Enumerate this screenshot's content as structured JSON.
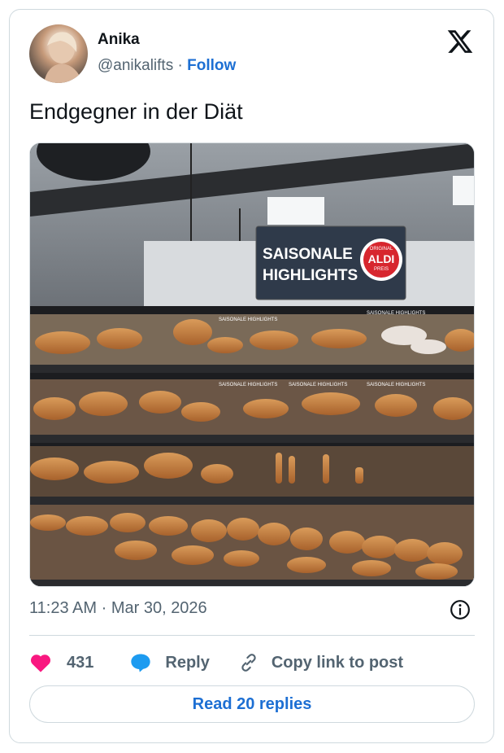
{
  "author": {
    "name": "Anika",
    "handle": "@anikalifts",
    "separator": "·",
    "follow_label": "Follow"
  },
  "post": {
    "text": "Endgegner in der Diät",
    "time": "11:23 AM",
    "date_separator": "·",
    "date": "Mar 30, 2026"
  },
  "photo": {
    "sign_line1": "SAISONALE",
    "sign_line2": "HIGHLIGHTS",
    "badge_top": "ORIGINAL",
    "badge_brand": "ALDI",
    "badge_bottom": "PREIS",
    "shelf_label": "SAISONALE HIGHLIGHTS"
  },
  "actions": {
    "like_count": "431",
    "reply_label": "Reply",
    "copy_label": "Copy link to post"
  },
  "read_replies_label": "Read 20 replies",
  "colors": {
    "accent": "#1d6fd3",
    "heart": "#f91880",
    "reply_bubble": "#1d9bf0",
    "secondary_text": "#536471"
  },
  "icons": [
    "x-logo-icon",
    "info-icon",
    "heart-icon",
    "reply-bubble-icon",
    "link-icon"
  ]
}
